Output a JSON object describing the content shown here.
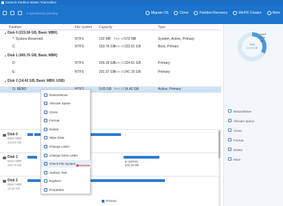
{
  "window": {
    "title": "EaseUS Partition Master Trial Edition"
  },
  "toolbar": {
    "pending_label": "0 operation(s) pending",
    "items": [
      {
        "label": "Migrate OS",
        "icon": "migrate-icon"
      },
      {
        "label": "Clone",
        "icon": "clone-icon"
      },
      {
        "label": "Partition Recovery",
        "icon": "recovery-icon"
      },
      {
        "label": "WinPE Creator",
        "icon": "winpe-icon"
      },
      {
        "label": "More",
        "icon": "more-icon"
      }
    ]
  },
  "table": {
    "headers": {
      "partition": "Partition",
      "file_system": "File system",
      "capacity": "Capacity",
      "type": "Type"
    },
    "disks": [
      {
        "label": "Disk 0 (223.58 GB, Basic MBR)",
        "partitions": [
          {
            "name": "*: System Reserved",
            "fs": "NTFS",
            "used": "120 MB",
            "free_of": "free of",
            "total": "579 MB",
            "type": "System, Active, Primary"
          },
          {
            "name": "C:",
            "fs": "NTFS",
            "used": "153.76 GB",
            "free_of": "free of",
            "total": "223.01 GB",
            "type": "Boot, Primary"
          }
        ]
      },
      {
        "label": "Disk 1 (465.76 GB, Basic MBR)",
        "partitions": [
          {
            "name": "D:",
            "fs": "NTFS",
            "used": "209.26 GB",
            "free_of": "free of",
            "total": "224.61 GB",
            "type": "Primary"
          },
          {
            "name": "E:",
            "fs": "NTFS",
            "used": "201.07 GB",
            "free_of": "free of",
            "total": "241.15 GB",
            "type": "Primary"
          }
        ]
      },
      {
        "label": "Disk 2 (14.42 GB, Basic MBR, USB)",
        "partitions": [
          {
            "name": "G: BEBO",
            "fs": "NTFS",
            "used": "9.65 GB",
            "free_of": "free of",
            "total": "14.42 GB",
            "type": "Active, Primary"
          }
        ]
      }
    ]
  },
  "right_panel": {
    "used_label": "Used",
    "used_value": "4.76 GB",
    "total_label": "Total",
    "total_value": "14.42 GB",
    "used_fraction": 0.33,
    "actions": [
      "Resize/Move",
      "Allocate Space",
      "Clone",
      "Format",
      "Delete",
      "More"
    ]
  },
  "context_menu": {
    "items": [
      "Resize/Move",
      "Allocate Space",
      "Clone",
      "Format",
      "Delete",
      "Wipe Data",
      "Change Label",
      "Change Drive Letter",
      "Check File System",
      "Surface Test",
      "Explorer",
      "Properties"
    ],
    "highlighted": "Check File System"
  },
  "disk_map": [
    {
      "name": "Disk 0",
      "sub1": "Basic MBR",
      "sub2": "223.58 GB",
      "segments": [
        {
          "label": "",
          "size": ""
        }
      ]
    },
    {
      "name": "Disk 1",
      "sub1": "Basic MBR",
      "sub2": "465.76 GB",
      "segments": [
        {
          "label": "",
          "size": ""
        },
        {
          "label": "E: (NTFS)",
          "size": "241.15 GB"
        }
      ]
    },
    {
      "name": "Disk 2",
      "sub1": "Basic MBR",
      "sub2": "14.42 GB",
      "segments": []
    }
  ],
  "legend": {
    "primary": "Primary"
  },
  "colors": {
    "titlebar": "#1a6fc2",
    "toolbar": "#1c74cc",
    "accent": "#2b7cd3",
    "selected_row": "#cfe2f6",
    "arrow": "#d32f2f"
  }
}
